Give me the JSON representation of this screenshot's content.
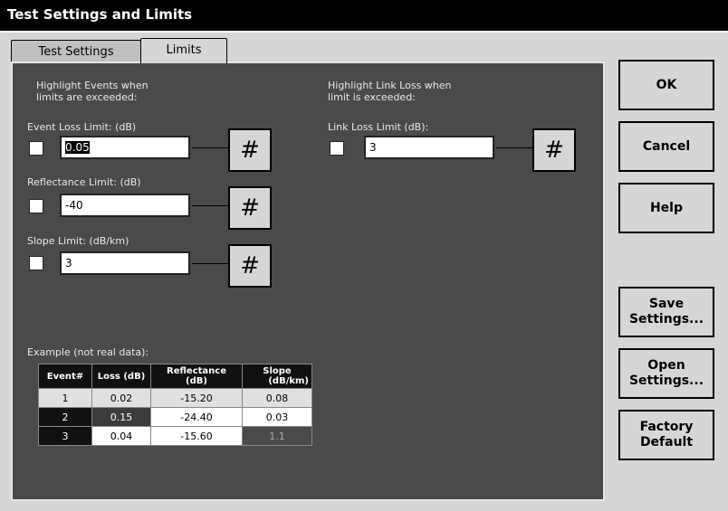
{
  "window": {
    "title": "Test Settings and Limits"
  },
  "tabs": [
    {
      "label": "Test Settings"
    },
    {
      "label": "Limits"
    }
  ],
  "left": {
    "heading_line1": "Highlight Events when",
    "heading_line2": "limits are exceeded:",
    "event_loss": {
      "label": "Event Loss Limit: (dB)",
      "value": "0.05"
    },
    "reflectance": {
      "label": "Reflectance Limit: (dB)",
      "value": "-40"
    },
    "slope": {
      "label": "Slope Limit: (dB/km)",
      "value": "3"
    }
  },
  "right": {
    "heading_line1": "Highlight Link Loss when",
    "heading_line2": "limit is exceeded:",
    "link_loss": {
      "label": "Link Loss Limit (dB):",
      "value": "3"
    }
  },
  "keypad_symbol": "#",
  "example": {
    "label": "Example (not real data):",
    "headers": {
      "event": "Event#",
      "loss": "Loss (dB)",
      "refl_1": "Reflectance",
      "refl_2": "(dB)",
      "slope_1": "Slope",
      "slope_2": "(dB/km)"
    },
    "rows": [
      {
        "event": "1",
        "loss": "0.02",
        "reflectance": "-15.20",
        "slope": "0.08"
      },
      {
        "event": "2",
        "loss": "0.15",
        "reflectance": "-24.40",
        "slope": "0.03"
      },
      {
        "event": "3",
        "loss": "0.04",
        "reflectance": "-15.60",
        "slope": "1.1"
      }
    ]
  },
  "buttons": {
    "ok": "OK",
    "cancel": "Cancel",
    "help": "Help",
    "save": "Save\nSettings...",
    "open": "Open\nSettings...",
    "factory": "Factory\nDefault"
  }
}
